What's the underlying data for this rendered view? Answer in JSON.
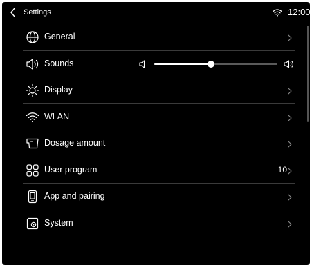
{
  "header": {
    "title": "Settings",
    "time": "12:00"
  },
  "colors": {
    "background": "#000000",
    "text": "#ffffff",
    "divider": "#3a3a3a",
    "slider_track": "#5a5a5a",
    "slider_fill": "#ffffff"
  },
  "items": [
    {
      "label": "General",
      "icon": "globe-icon"
    },
    {
      "label": "Sounds",
      "icon": "speaker-icon",
      "volume_percent": 46
    },
    {
      "label": "Display",
      "icon": "sun-icon"
    },
    {
      "label": "WLAN",
      "icon": "wifi-icon"
    },
    {
      "label": "Dosage amount",
      "icon": "cup-icon"
    },
    {
      "label": "User program",
      "icon": "grid-icon",
      "value": "10"
    },
    {
      "label": "App and pairing",
      "icon": "phone-icon"
    },
    {
      "label": "System",
      "icon": "system-settings-icon"
    }
  ]
}
